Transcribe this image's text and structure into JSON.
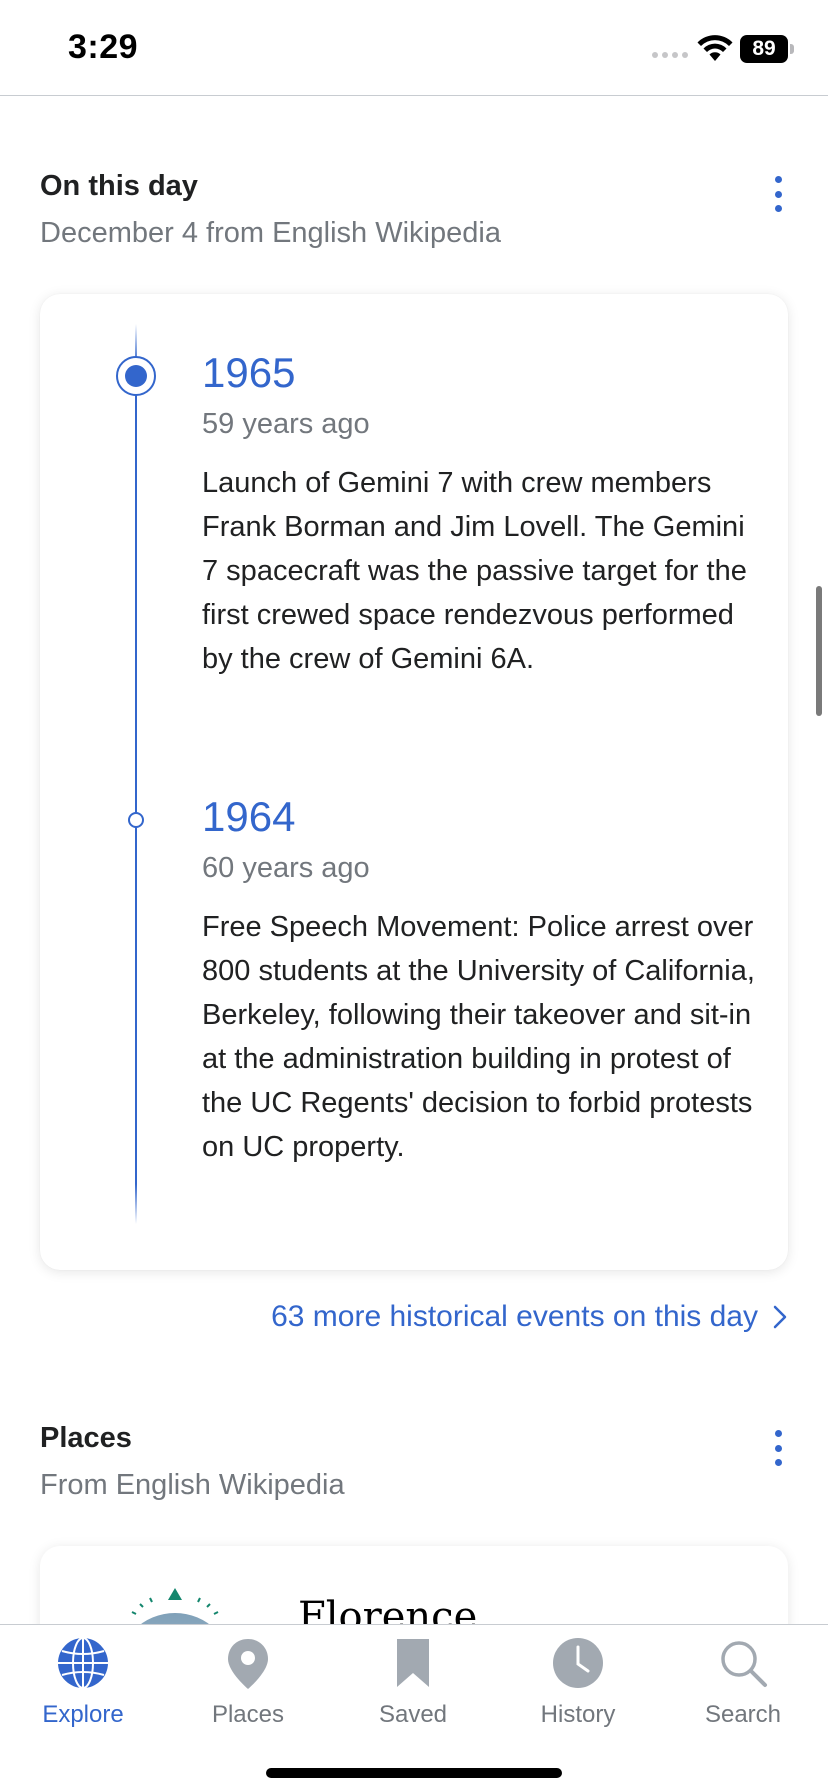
{
  "status_bar": {
    "time": "3:29",
    "battery": "89"
  },
  "on_this_day": {
    "title": "On this day",
    "subtitle": "December 4 from English Wikipedia",
    "events": [
      {
        "year": "1965",
        "ago": "59 years ago",
        "text": "Launch of Gemini 7 with crew members Frank Borman and Jim Lovell. The Gemini 7 spacecraft was the passive target for the first crewed space rendezvous performed by the crew of Gemini 6A."
      },
      {
        "year": "1964",
        "ago": "60 years ago",
        "text": "Free Speech Movement: Police arrest over 800 students at the University of California, Berkeley, following their takeover and sit-in at the administration building in protest of the UC Regents' decision to forbid protests on UC property."
      }
    ],
    "more_link": "63 more historical events on this day"
  },
  "places": {
    "title": "Places",
    "subtitle": "From English Wikipedia",
    "card_title": "Florence"
  },
  "tab_bar": {
    "tabs": [
      {
        "label": "Explore",
        "icon": "globe-icon",
        "active": true
      },
      {
        "label": "Places",
        "icon": "map-pin-icon",
        "active": false
      },
      {
        "label": "Saved",
        "icon": "bookmark-icon",
        "active": false
      },
      {
        "label": "History",
        "icon": "clock-icon",
        "active": false
      },
      {
        "label": "Search",
        "icon": "magnifier-icon",
        "active": false
      }
    ]
  },
  "colors": {
    "accent": "#3366cc",
    "muted": "#72777d",
    "text": "#202122"
  }
}
